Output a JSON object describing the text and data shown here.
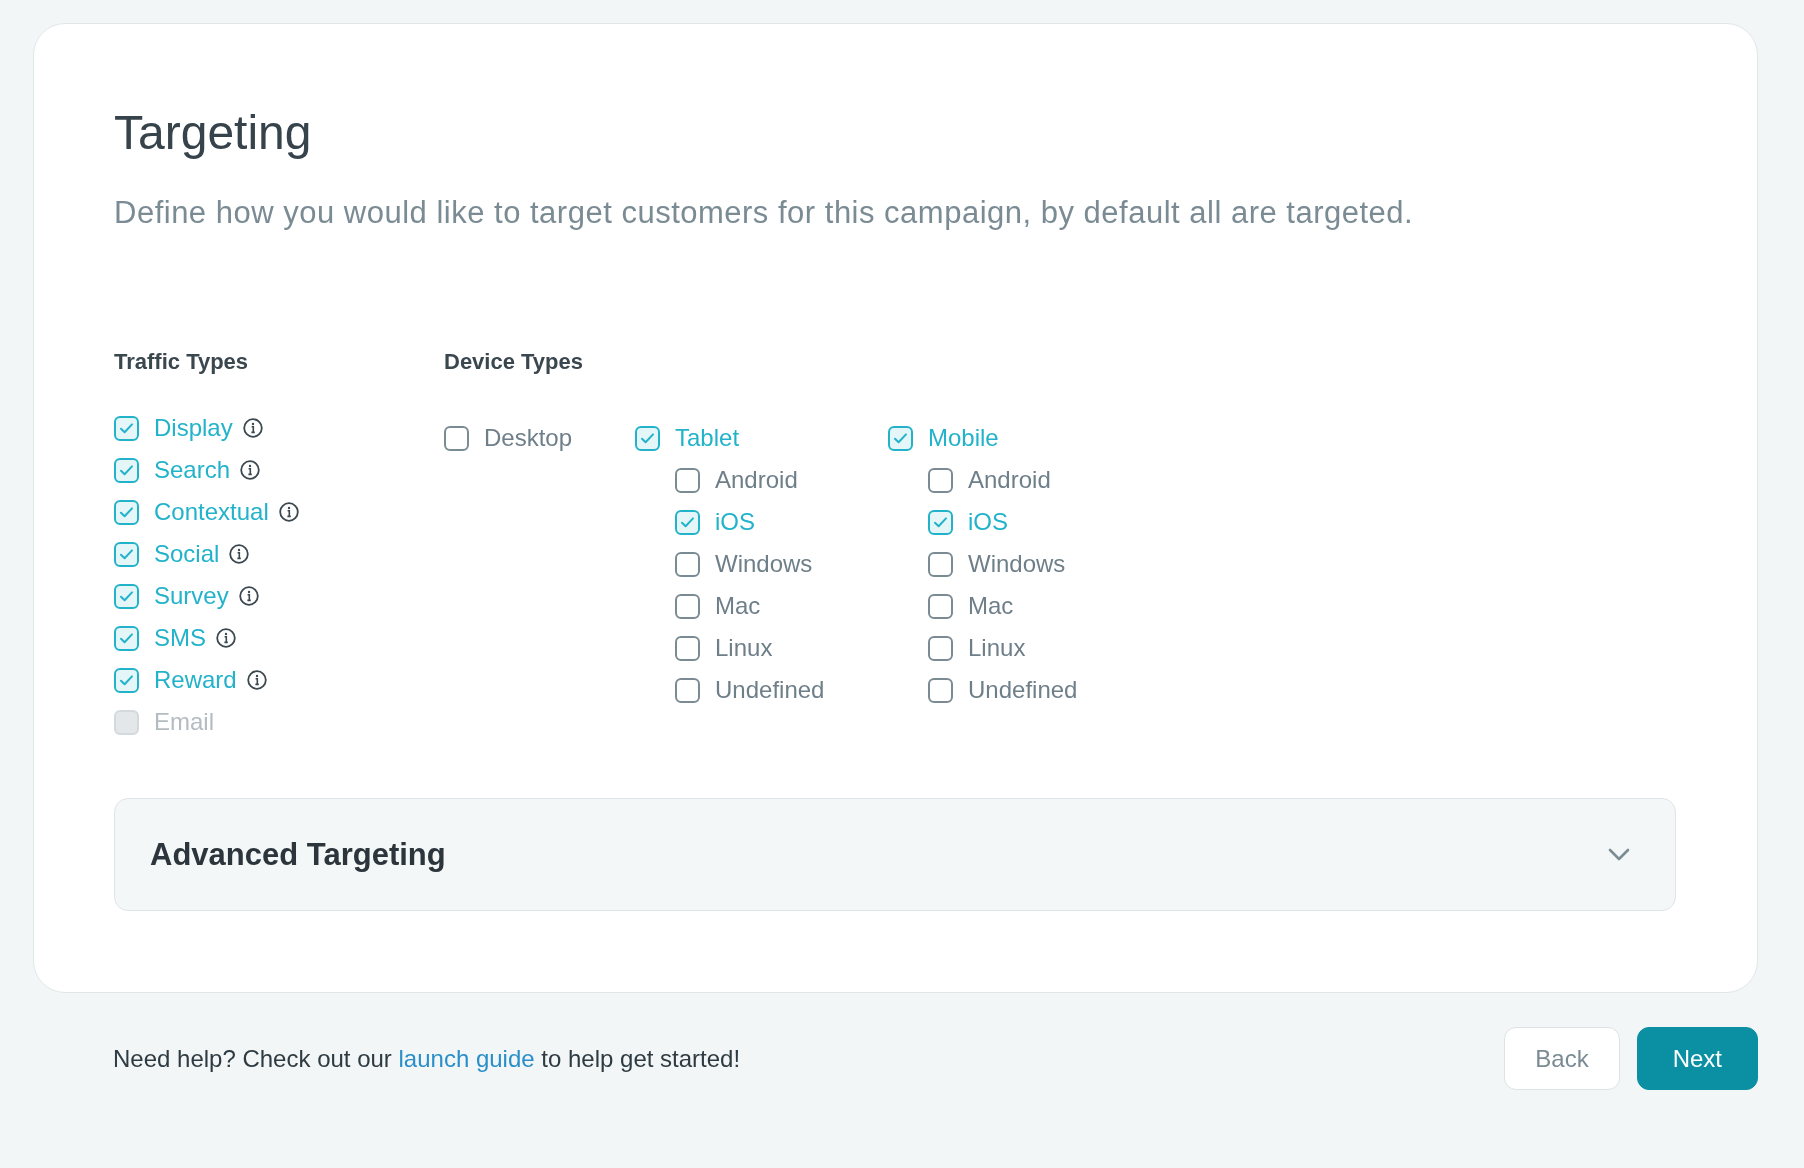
{
  "title": "Targeting",
  "description": "Define how you would like to target customers for this campaign, by default all are targeted.",
  "traffic_types": {
    "heading": "Traffic Types",
    "items": [
      {
        "label": "Display",
        "checked": true,
        "disabled": false,
        "has_info": true
      },
      {
        "label": "Search",
        "checked": true,
        "disabled": false,
        "has_info": true
      },
      {
        "label": "Contextual",
        "checked": true,
        "disabled": false,
        "has_info": true
      },
      {
        "label": "Social",
        "checked": true,
        "disabled": false,
        "has_info": true
      },
      {
        "label": "Survey",
        "checked": true,
        "disabled": false,
        "has_info": true
      },
      {
        "label": "SMS",
        "checked": true,
        "disabled": false,
        "has_info": true
      },
      {
        "label": "Reward",
        "checked": true,
        "disabled": false,
        "has_info": true
      },
      {
        "label": "Email",
        "checked": false,
        "disabled": true,
        "has_info": false
      }
    ]
  },
  "device_types": {
    "heading": "Device Types",
    "groups": [
      {
        "label": "Desktop",
        "checked": false
      },
      {
        "label": "Tablet",
        "checked": true,
        "children": [
          {
            "label": "Android",
            "checked": false
          },
          {
            "label": "iOS",
            "checked": true
          },
          {
            "label": "Windows",
            "checked": false
          },
          {
            "label": "Mac",
            "checked": false
          },
          {
            "label": "Linux",
            "checked": false
          },
          {
            "label": "Undefined",
            "checked": false
          }
        ]
      },
      {
        "label": "Mobile",
        "checked": true,
        "children": [
          {
            "label": "Android",
            "checked": false
          },
          {
            "label": "iOS",
            "checked": true
          },
          {
            "label": "Windows",
            "checked": false
          },
          {
            "label": "Mac",
            "checked": false
          },
          {
            "label": "Linux",
            "checked": false
          },
          {
            "label": "Undefined",
            "checked": false
          }
        ]
      }
    ]
  },
  "advanced_targeting": {
    "title": "Advanced Targeting",
    "expanded": false
  },
  "help": {
    "before": "Need help? Check out our ",
    "link": "launch guide",
    "after": " to help get started!"
  },
  "buttons": [
    {
      "label": "Back",
      "kind": "secondary"
    },
    {
      "label": "Next",
      "kind": "primary"
    }
  ]
}
